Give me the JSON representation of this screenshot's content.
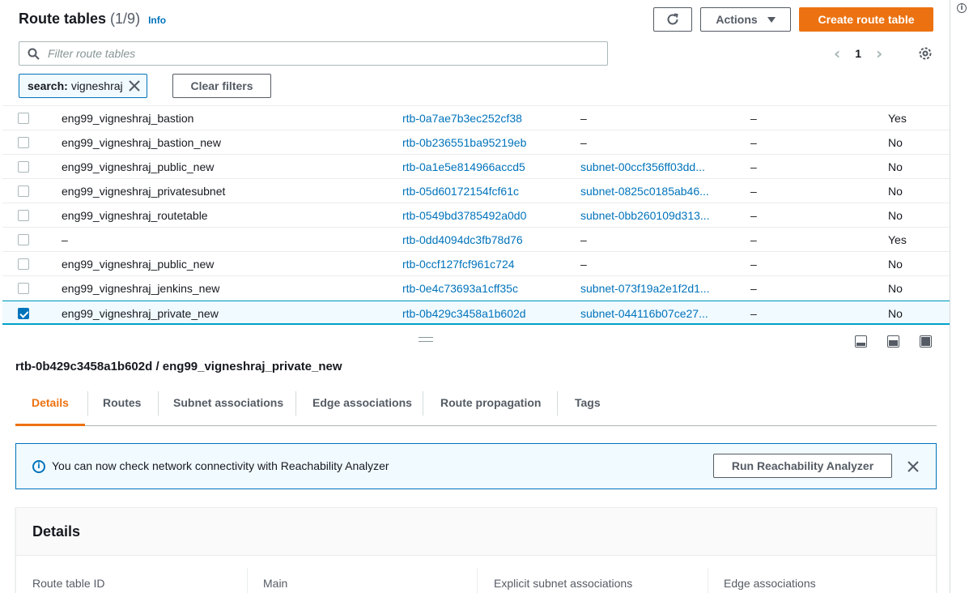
{
  "header": {
    "title": "Route tables",
    "count": "(1/9)",
    "info": "Info",
    "actions_label": "Actions",
    "create_label": "Create route table"
  },
  "search": {
    "placeholder": "Filter route tables"
  },
  "pagination": {
    "page": "1"
  },
  "filter_token": {
    "key": "search:",
    "value": "vigneshraj"
  },
  "clear_filters_label": "Clear filters",
  "table": {
    "rows": [
      {
        "name": "eng99_vigneshraj_bastion",
        "id": "rtb-0a7ae7b3ec252cf38",
        "subnet": "–",
        "edge": "–",
        "main": "Yes",
        "checked": false
      },
      {
        "name": "eng99_vigneshraj_bastion_new",
        "id": "rtb-0b236551ba95219eb",
        "subnet": "–",
        "edge": "–",
        "main": "No",
        "checked": false
      },
      {
        "name": "eng99_vigneshraj_public_new",
        "id": "rtb-0a1e5e814966accd5",
        "subnet": "subnet-00ccf356ff03dd...",
        "edge": "–",
        "main": "No",
        "checked": false
      },
      {
        "name": "eng99_vigneshraj_privatesubnet",
        "id": "rtb-05d60172154fcf61c",
        "subnet": "subnet-0825c0185ab46...",
        "edge": "–",
        "main": "No",
        "checked": false
      },
      {
        "name": "eng99_vigneshraj_routetable",
        "id": "rtb-0549bd3785492a0d0",
        "subnet": "subnet-0bb260109d313...",
        "edge": "–",
        "main": "No",
        "checked": false
      },
      {
        "name": "–",
        "id": "rtb-0dd4094dc3fb78d76",
        "subnet": "–",
        "edge": "–",
        "main": "Yes",
        "checked": false
      },
      {
        "name": "eng99_vigneshraj_public_new",
        "id": "rtb-0ccf127fcf961c724",
        "subnet": "–",
        "edge": "–",
        "main": "No",
        "checked": false
      },
      {
        "name": "eng99_vigneshraj_jenkins_new",
        "id": "rtb-0e4c73693a1cff35c",
        "subnet": "subnet-073f19a2e1f2d1...",
        "edge": "–",
        "main": "No",
        "checked": false
      },
      {
        "name": "eng99_vigneshraj_private_new",
        "id": "rtb-0b429c3458a1b602d",
        "subnet": "subnet-044116b07ce27...",
        "edge": "–",
        "main": "No",
        "checked": true
      }
    ]
  },
  "detail": {
    "title": "rtb-0b429c3458a1b602d / eng99_vigneshraj_private_new",
    "tabs": [
      "Details",
      "Routes",
      "Subnet associations",
      "Edge associations",
      "Route propagation",
      "Tags"
    ],
    "alert_text": "You can now check network connectivity with Reachability Analyzer",
    "alert_button": "Run Reachability Analyzer",
    "card_title": "Details",
    "fields": [
      "Route table ID",
      "Main",
      "Explicit subnet associations",
      "Edge associations"
    ]
  },
  "colors": {
    "primary": "#ec7211",
    "link": "#0073bb",
    "selected_bg": "#f1faff"
  }
}
